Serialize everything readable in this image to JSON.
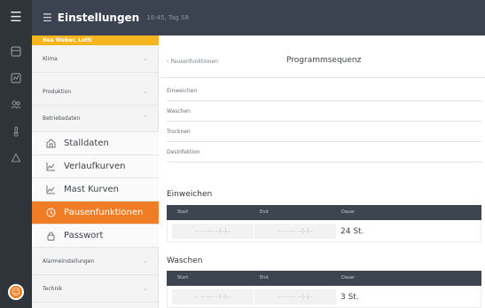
{
  "rail": {
    "icons": [
      "menu-icon",
      "dashboard-icon",
      "chart-icon",
      "people-icon",
      "thermometer-icon",
      "alarm-icon"
    ],
    "avatar_icon": "user-avatar-icon"
  },
  "header": {
    "title": "Einstellungen",
    "meta": "18:45, Tag 58"
  },
  "user_strip": "Bea Weber, Lotti",
  "sidebar": {
    "categories": [
      {
        "label": "Klima"
      },
      {
        "label": "Produktion"
      },
      {
        "label": "Betriebsdaten"
      },
      {
        "label": "Alarmeinstellungen"
      },
      {
        "label": "Technik"
      }
    ],
    "subitems": [
      {
        "label": "Stalldaten",
        "icon": "home-icon"
      },
      {
        "label": "Verlaufkurven",
        "icon": "line-chart-icon"
      },
      {
        "label": "Mast Kurven",
        "icon": "line-chart-icon"
      },
      {
        "label": "Pausenfunktionen",
        "icon": "clock-icon"
      },
      {
        "label": "Passwort",
        "icon": "lock-icon"
      }
    ]
  },
  "main": {
    "back_label": "Pausenfunktionen",
    "page_title": "Programmsequenz",
    "subnav": [
      "Einweichen",
      "Waschen",
      "Trocknen",
      "Desinfektion"
    ],
    "columns": {
      "start": "Start",
      "end": "End",
      "duration": "Dauer"
    },
    "sections": [
      {
        "title": "Einweichen",
        "start": "-- -- ---- --|--|--",
        "end": "-- -- ---- --|--|--",
        "duration": "24 St."
      },
      {
        "title": "Waschen",
        "start": "-- -- ---- --|--|--",
        "end": "-- -- ---- --|--|--",
        "duration": "3 St."
      }
    ]
  },
  "colors": {
    "accent": "#f07d26",
    "header_bg": "#3c4350",
    "rail_bg": "#2f343b",
    "user_strip": "#f4b51f",
    "table_header": "#3d4551"
  }
}
